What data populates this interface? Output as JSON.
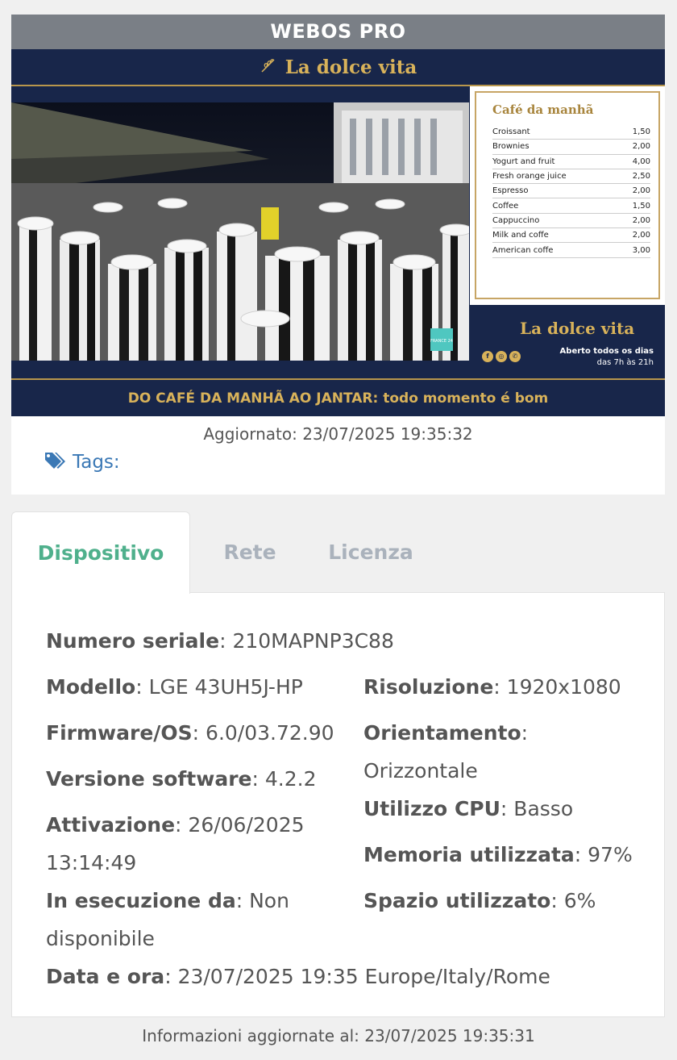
{
  "device": {
    "title": "WEBOS PRO",
    "updated_label": "Aggiornato:",
    "updated_value": "23/07/2025 19:35:32",
    "tags_label": "Tags:"
  },
  "screen": {
    "brand": "La dolce vita",
    "menu_title": "Café da manhã",
    "menu_items": [
      {
        "name": "Croissant",
        "price": "1,50"
      },
      {
        "name": "Brownies",
        "price": "2,00"
      },
      {
        "name": "Yogurt and fruit",
        "price": "4,00"
      },
      {
        "name": "Fresh orange juice",
        "price": "2,50"
      },
      {
        "name": "Espresso",
        "price": "2,00"
      },
      {
        "name": "Coffee",
        "price": "1,50"
      },
      {
        "name": "Cappuccino",
        "price": "2,00"
      },
      {
        "name": "Milk and coffe",
        "price": "2,00"
      },
      {
        "name": "American coffe",
        "price": "3,00"
      }
    ],
    "side_brand": "La dolce vita",
    "open_line1": "Aberto todos os dias",
    "open_line2": "das 7h às 21h",
    "tagline": "DO CAFÉ DA MANHÃ AO JANTAR: todo momento é bom",
    "video_badge": "FRANCE 24"
  },
  "tabs": [
    "Dispositivo",
    "Rete",
    "Licenza"
  ],
  "info": {
    "serial": {
      "label": "Numero seriale",
      "value": "210MAPNP3C88"
    },
    "model": {
      "label": "Modello",
      "value": "LGE 43UH5J-HP"
    },
    "firmware": {
      "label": "Firmware/OS",
      "value": "6.0/03.72.90"
    },
    "software": {
      "label": "Versione software",
      "value": "4.2.2"
    },
    "activation": {
      "label": "Attivazione",
      "value": "26/06/2025 13:14:49"
    },
    "running": {
      "label": "In esecuzione da",
      "value": "Non disponibile"
    },
    "datetime": {
      "label": "Data e ora",
      "value": "23/07/2025 19:35 Europe/Italy/Rome"
    },
    "resolution": {
      "label": "Risoluzione",
      "value": "1920x1080"
    },
    "orientation": {
      "label": "Orientamento",
      "value": "Orizzontale"
    },
    "cpu": {
      "label": "Utilizzo CPU",
      "value": "Basso"
    },
    "memory": {
      "label": "Memoria utilizzata",
      "value": "97%"
    },
    "disk": {
      "label": "Spazio utilizzato",
      "value": "6%"
    }
  },
  "footer": {
    "label": "Informazioni aggiornate al:",
    "value": "23/07/2025 19:35:31"
  },
  "colors": {
    "navy": "#18264a",
    "gold": "#d8b25a",
    "active_tab": "#4fb08c",
    "header_gray": "#7a7f86",
    "tag_blue": "#3a78b5"
  },
  "icons": [
    "leaf-icon",
    "tag-icon",
    "facebook-icon",
    "instagram-icon",
    "whatsapp-icon"
  ]
}
